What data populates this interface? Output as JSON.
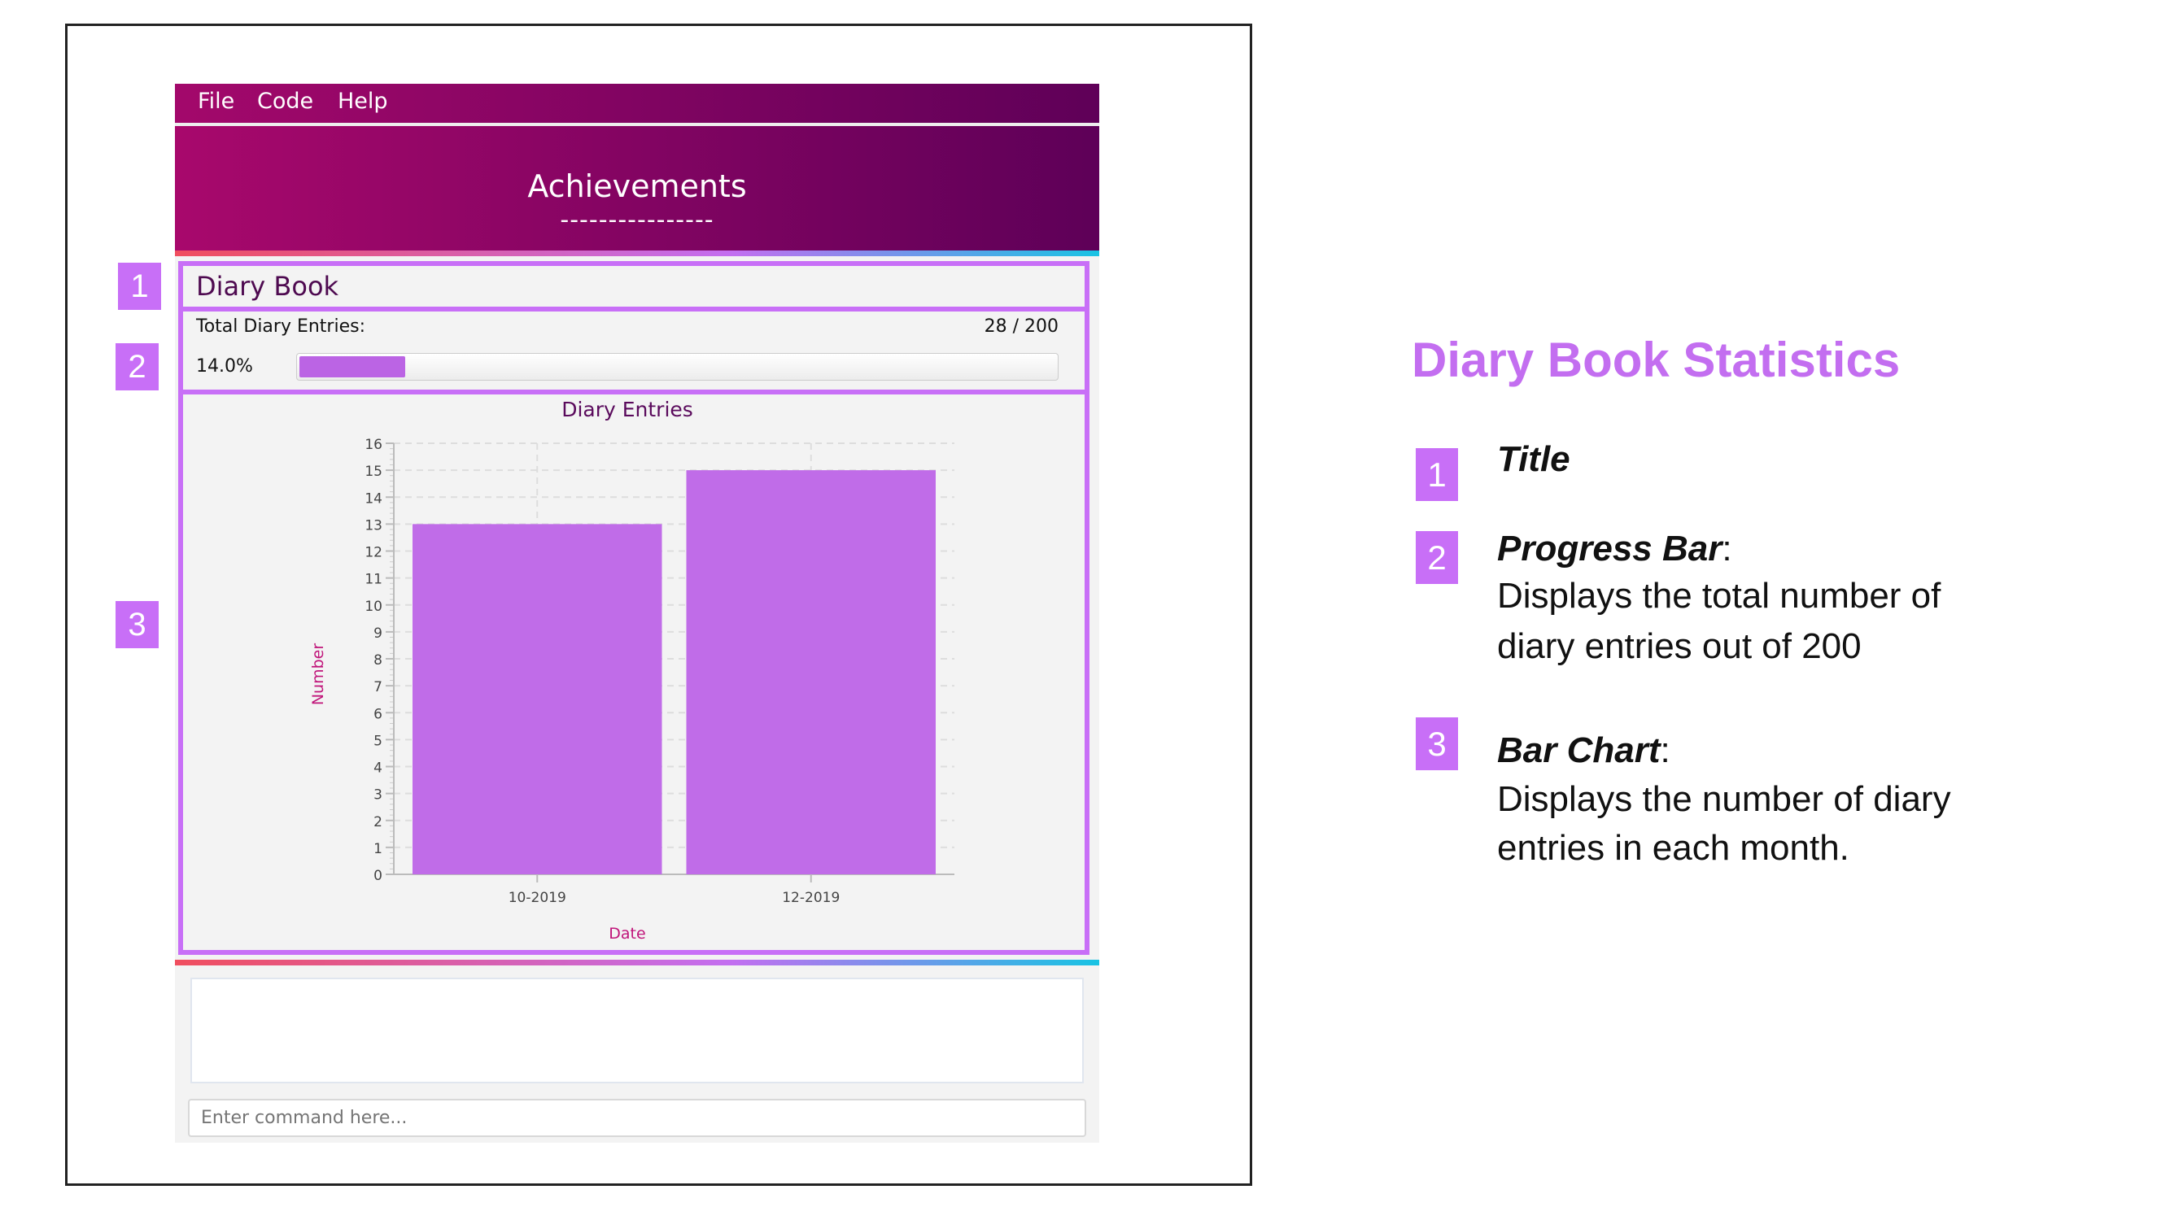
{
  "app": {
    "menu": [
      "File",
      "Code",
      "Help"
    ],
    "header_title": "Achievements",
    "header_underline": "----------------",
    "panel_title": "Diary Book",
    "progress": {
      "label": "Total Diary Entries:",
      "count_text": "28 / 200",
      "percent_text": "14.0%",
      "value": 28,
      "max": 200,
      "fraction": 0.14
    },
    "command_placeholder": "Enter command here...",
    "result_text": ""
  },
  "chart_data": {
    "type": "bar",
    "title": "Diary Entries",
    "xlabel": "Date",
    "ylabel": "Number",
    "categories": [
      "10-2019",
      "12-2019"
    ],
    "values": [
      13,
      15
    ],
    "ylim": [
      0,
      16
    ],
    "yticks": [
      0,
      1,
      2,
      3,
      4,
      5,
      6,
      7,
      8,
      9,
      10,
      11,
      12,
      13,
      14,
      15,
      16
    ],
    "grid": true,
    "bar_color": "#c06ce8"
  },
  "callouts": {
    "box1": "1",
    "box2": "2",
    "box3": "3"
  },
  "legend": {
    "title": "Diary Book Statistics",
    "items": [
      {
        "num": "1",
        "heading": "Title",
        "lines": []
      },
      {
        "num": "2",
        "heading": "Progress Bar",
        "lines": [
          "Displays the total number of",
          "diary entries out of 200"
        ]
      },
      {
        "num": "3",
        "heading": "Bar Chart",
        "lines": [
          "Displays the number of diary",
          "entries in each month."
        ]
      }
    ]
  },
  "colors": {
    "accent": "#c86ff7",
    "header_start": "#a8086c",
    "header_end": "#5e0058"
  }
}
